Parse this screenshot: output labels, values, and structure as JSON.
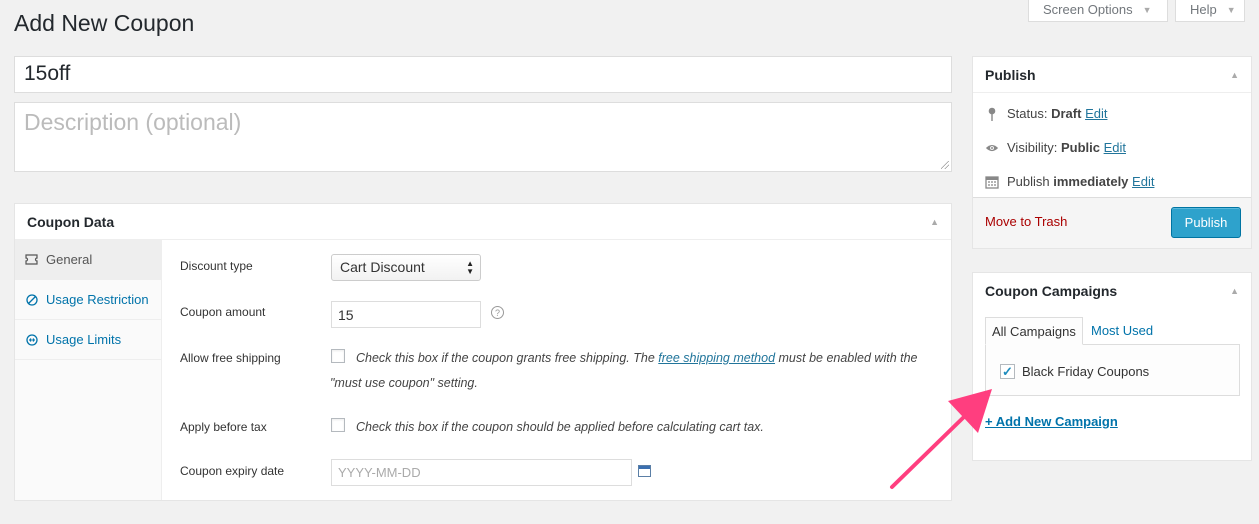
{
  "header": {
    "title": "Add New Coupon",
    "screen_options": "Screen Options",
    "help": "Help"
  },
  "coupon": {
    "code_value": "15off",
    "description_placeholder": "Description (optional)"
  },
  "coupon_data": {
    "heading": "Coupon Data",
    "tabs": [
      {
        "label": "General",
        "icon": "ticket-icon",
        "active": true
      },
      {
        "label": "Usage Restriction",
        "icon": "ban-icon",
        "active": false
      },
      {
        "label": "Usage Limits",
        "icon": "limits-icon",
        "active": false
      }
    ],
    "fields": {
      "discount_type_label": "Discount type",
      "discount_type_value": "Cart Discount",
      "amount_label": "Coupon amount",
      "amount_value": "15",
      "free_shipping_label": "Allow free shipping",
      "free_shipping_desc_pre": "Check this box if the coupon grants free shipping. The",
      "free_shipping_link": "free shipping method",
      "free_shipping_desc_post": "must be enabled with the",
      "free_shipping_desc_line2": "\"must use coupon\" setting.",
      "before_tax_label": "Apply before tax",
      "before_tax_desc": "Check this box if the coupon should be applied before calculating cart tax.",
      "expiry_label": "Coupon expiry date",
      "expiry_placeholder": "YYYY-MM-DD"
    }
  },
  "publish": {
    "heading": "Publish",
    "status_label": "Status:",
    "status_value": "Draft",
    "visibility_label": "Visibility:",
    "visibility_value": "Public",
    "publish_label": "Publish",
    "publish_value": "immediately",
    "edit": "Edit",
    "trash": "Move to Trash",
    "button": "Publish"
  },
  "campaigns": {
    "heading": "Coupon Campaigns",
    "tab_all": "All Campaigns",
    "tab_most_used": "Most Used",
    "items": [
      {
        "label": "Black Friday Coupons",
        "checked": true
      }
    ],
    "add_new": "+ Add New Campaign"
  },
  "colors": {
    "accent": "#0073aa",
    "publish_button": "#2ea2cc",
    "trash": "#aa0000",
    "annotation_arrow": "#ff3e7f"
  }
}
